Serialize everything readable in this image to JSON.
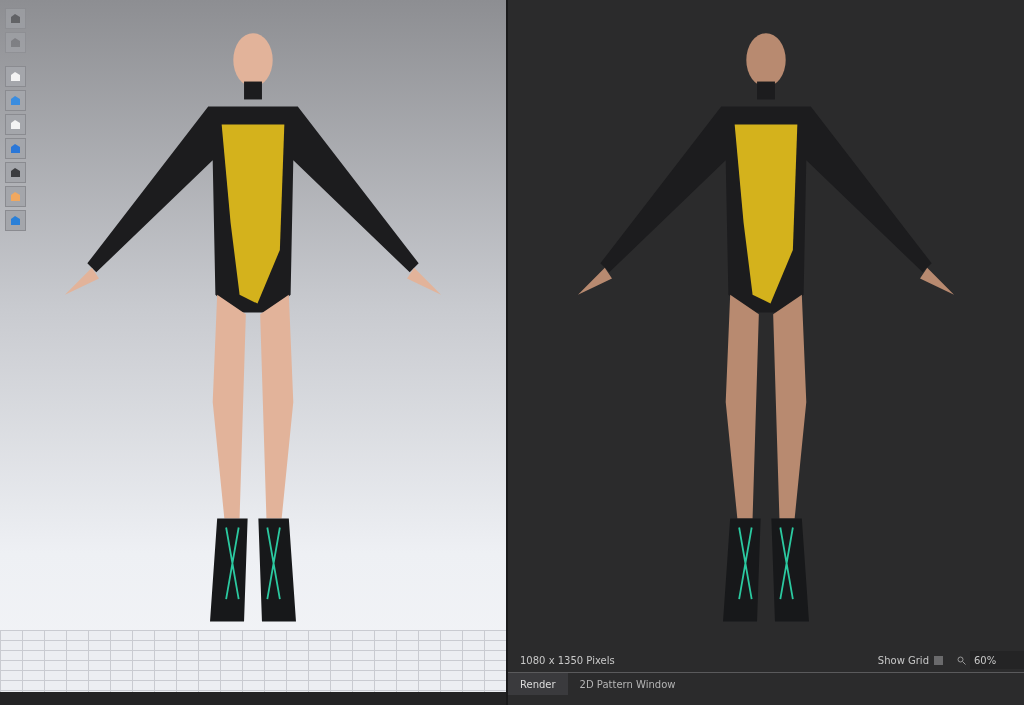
{
  "viewport": {
    "toolbar": [
      {
        "disabled": true
      },
      {
        "disabled": true
      },
      {
        "disabled": false
      },
      {
        "disabled": false
      },
      {
        "disabled": false
      },
      {
        "disabled": false
      },
      {
        "disabled": false
      },
      {
        "disabled": false
      },
      {
        "disabled": false
      }
    ]
  },
  "render": {
    "resolution": "1080 x 1350 Pixels",
    "show_grid": {
      "label": "Show Grid",
      "checked": false
    },
    "zoom": {
      "value": "60%"
    }
  },
  "tabs": [
    {
      "label": "Render",
      "selected": true
    },
    {
      "label": "2D Pattern Window",
      "selected": false
    }
  ]
}
